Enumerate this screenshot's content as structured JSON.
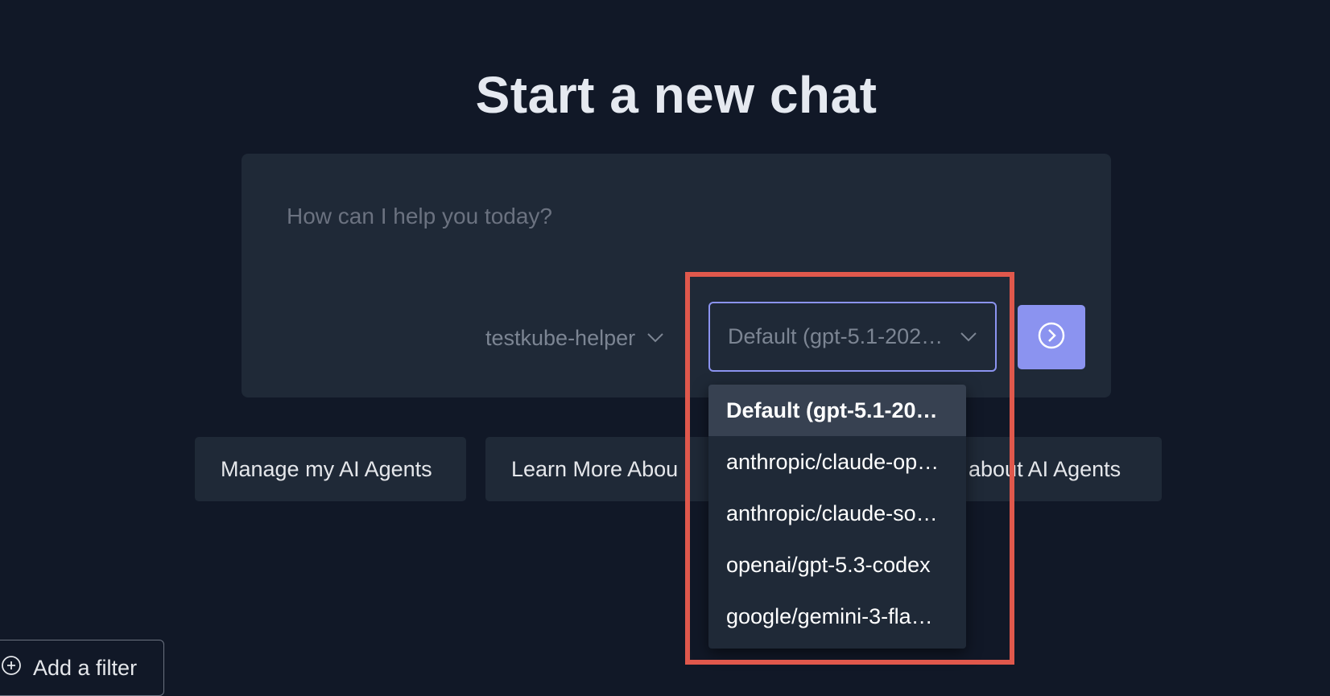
{
  "page": {
    "title": "Start a new chat"
  },
  "composer": {
    "placeholder": "How can I help you today?",
    "agent": "testkube-helper",
    "model": "Default (gpt-5.1-202…"
  },
  "actions": {
    "manage_agents": "Manage my AI Agents",
    "learn_more": "Learn More Abou",
    "learn_more_tail": "about AI Agents"
  },
  "model_dropdown": {
    "options": [
      "Default (gpt-5.1-20…",
      "anthropic/claude-op…",
      "anthropic/claude-so…",
      "openai/gpt-5.3-codex",
      "google/gemini-3-fla…"
    ],
    "selected_index": 0
  },
  "filter": {
    "label": "Add a filter"
  },
  "colors": {
    "background": "#111827",
    "panel": "#1f2937",
    "accent": "#8b93f0",
    "highlight": "#e0584c"
  },
  "icons": {
    "agent_chevron": "chevron-down-icon",
    "model_chevron": "chevron-down-icon",
    "send": "arrow-right-circle-icon",
    "filter": "plus-circle-icon"
  }
}
